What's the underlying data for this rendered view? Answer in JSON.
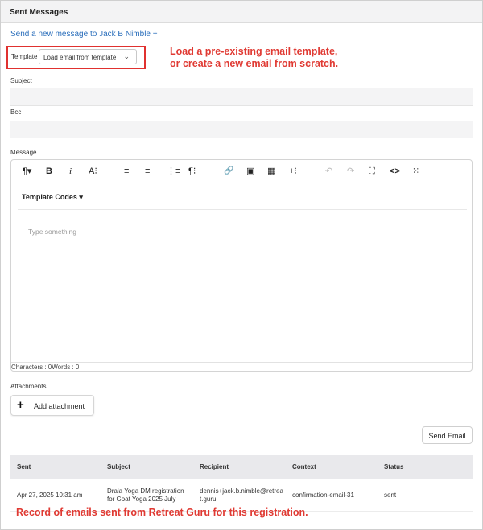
{
  "header": {
    "title": "Sent Messages"
  },
  "send_link": "Send a new message to Jack B Nimble +",
  "template": {
    "label": "Template",
    "selected": "Load email from template"
  },
  "annotations": {
    "template_line1": "Load a pre-existing email template,",
    "template_line2": "or create a new email from scratch.",
    "record": "Record of emails sent from Retreat Guru for this registration."
  },
  "subject": {
    "label": "Subject",
    "value": ""
  },
  "bcc": {
    "label": "Bcc",
    "value": ""
  },
  "message": {
    "label": "Message",
    "toolbar": {
      "paragraph_format": "¶▾",
      "bold": "B",
      "italic": "i",
      "font_size": "A⁝",
      "align_left": "≡",
      "align_center": "≡",
      "ordered_list": "⋮≡",
      "paragraph_style": "¶⁝",
      "link": "🔗",
      "image": "▣",
      "table": "▦",
      "more": "+⁝",
      "undo": "↶",
      "redo": "↷",
      "fullscreen": "⛶",
      "code_view": "<>",
      "select_all": "⁙"
    },
    "template_codes": "Template Codes ▾",
    "placeholder": "Type something",
    "counter": "Characters : 0Words : 0"
  },
  "attachments": {
    "label": "Attachments",
    "button": "Add attachment"
  },
  "send_button": "Send Email",
  "table": {
    "headers": [
      "Sent",
      "Subject",
      "Recipient",
      "Context",
      "Status"
    ],
    "rows": [
      {
        "sent": "Apr 27, 2025 10:31 am",
        "subject_line1": "Drala Yoga DM registration",
        "subject_line2": "for Goat Yoga 2025 July",
        "recipient_line1": "dennis+jack.b.nimble@retrea",
        "recipient_line2": "t.guru",
        "context": "confirmation-email-31",
        "status": "sent"
      }
    ]
  },
  "colors": {
    "link": "#2a6ebb",
    "annotation": "#e03a33",
    "header_bg": "#f3f3f4"
  }
}
